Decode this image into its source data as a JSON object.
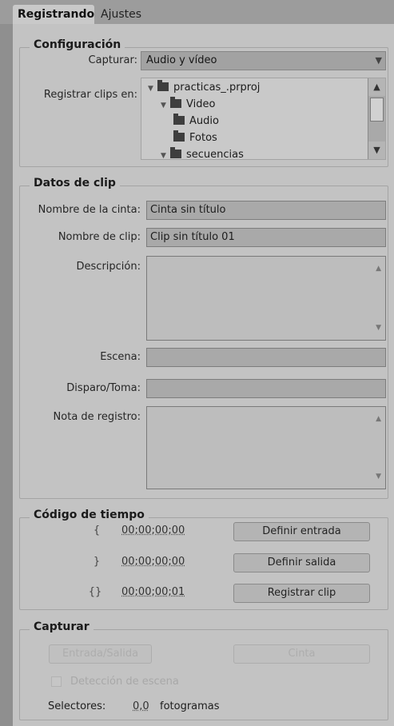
{
  "tabs": [
    {
      "label": "Registrando",
      "active": true
    },
    {
      "label": "Ajustes",
      "active": false
    }
  ],
  "config": {
    "title": "Configuración",
    "capture_label": "Capturar:",
    "capture_value": "Audio y vídeo",
    "register_label": "Registrar clips en:",
    "tree": [
      {
        "label": "practicas_.prproj",
        "level": 0,
        "expanded": true
      },
      {
        "label": "Video",
        "level": 1,
        "expanded": true
      },
      {
        "label": "Audio",
        "level": 2
      },
      {
        "label": "Fotos",
        "level": 2
      },
      {
        "label": "secuencias",
        "level": 1,
        "expanded": true
      }
    ]
  },
  "clip": {
    "title": "Datos de clip",
    "tape_label": "Nombre de la cinta:",
    "tape_value": "Cinta sin título",
    "clip_label": "Nombre de clip:",
    "clip_value": "Clip sin título 01",
    "desc_label": "Descripción:",
    "scene_label": "Escena:",
    "shot_label": "Disparo/Toma:",
    "log_label": "Nota de registro:"
  },
  "timecode": {
    "title": "Código de tiempo",
    "in_value": "00;00;00;00",
    "out_value": "00;00;00;00",
    "dur_value": "00;00;00;01",
    "set_in": "Definir entrada",
    "set_out": "Definir salida",
    "log_clip": "Registrar clip"
  },
  "capture": {
    "title": "Capturar",
    "in_out": "Entrada/Salida",
    "tape": "Cinta",
    "scene_detect": "Detección de escena",
    "handles_label": "Selectores:",
    "handles_value": "0,0",
    "handles_unit": "fotogramas"
  }
}
